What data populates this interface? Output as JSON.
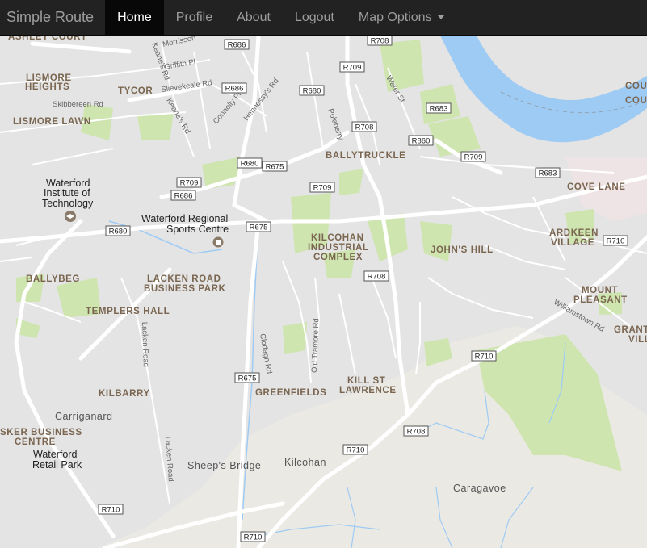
{
  "navbar": {
    "brand": "Simple Route",
    "items": [
      {
        "label": "Home",
        "active": true
      },
      {
        "label": "Profile",
        "active": false
      },
      {
        "label": "About",
        "active": false
      },
      {
        "label": "Logout",
        "active": false
      }
    ],
    "dropdown": {
      "label": "Map Options"
    }
  },
  "map": {
    "colors": {
      "land": "#ebe9e4",
      "urban": "#e4e4e4",
      "park": "#cfe5b0",
      "water": "#9ecbf4",
      "road": "#ffffff",
      "major_road": "#fbfbfb"
    },
    "areas": {
      "ashley_court": "ASHLEY COURT",
      "lismore_heights_1": "LISMORE",
      "lismore_heights_2": "HEIGHTS",
      "tycor": "TYCOR",
      "lismore_lawn": "LISMORE LAWN",
      "ballytruckle": "BALLYTRUCKLE",
      "cove_lane": "COVE LANE",
      "kilcohan_1": "KILCOHAN",
      "kilcohan_2": "INDUSTRIAL",
      "kilcohan_3": "COMPLEX",
      "johns_hill": "JOHN'S HILL",
      "ardkeen_1": "ARDKEEN",
      "ardkeen_2": "VILLAGE",
      "ballybeg": "BALLYBEG",
      "lacken_1": "LACKEN ROAD",
      "lacken_2": "BUSINESS PARK",
      "templers_hall": "TEMPLERS HALL",
      "mount_pleasant_1": "MOUNT",
      "mount_pleasant_2": "PLEASANT",
      "grant_1": "GRANT",
      "grant_2": "VILL",
      "kilbarry": "KILBARRY",
      "greenfields": "GREENFIELDS",
      "kill_st_lawrence_1": "KILL ST",
      "kill_st_lawrence_2": "LAWRENCE",
      "sker_business_1": "SKER BUSINESS",
      "sker_business_2": "CENTRE",
      "count_1": "COUN",
      "count_2": "COUN"
    },
    "pois": {
      "wit_1": "Waterford",
      "wit_2": "Institute of",
      "wit_3": "Technology",
      "sports_1": "Waterford Regional",
      "sports_2": "Sports Centre",
      "retail_1": "Waterford",
      "retail_2": "Retail Park"
    },
    "places": {
      "carriganard": "Carriganard",
      "sheeps_bridge": "Sheep's Bridge",
      "kilcohan": "Kilcohan",
      "caragavoe": "Caragavoe"
    },
    "streets": {
      "morrisson": "Morrisson",
      "griffith": "Griffith Pl",
      "slievekeale": "Slievekeale Rd",
      "keanes_1": "Keane's Rd",
      "keanes_2": "Keane's Rd",
      "skibbereen": "Skibbereen Rd",
      "connolly": "Connolly Pl",
      "hennessys": "Hennessy's Rd",
      "water_st": "Water St",
      "poleberry": "Poleberry",
      "lacken_road_1": "Lacken Road",
      "lacken_road_2": "Lacken Road",
      "clodagh": "Clodagh Rd",
      "old_tramore": "Old Tramore Rd",
      "williamstown": "Williamstown Rd"
    },
    "shields": {
      "s1": "R708",
      "s2": "R686",
      "s3": "R709",
      "s4": "R686",
      "s5": "R680",
      "s6": "R683",
      "s7": "R708",
      "s8": "R860",
      "s9": "R709",
      "s10": "R683",
      "s11": "R680",
      "s12": "R675",
      "s13": "R709",
      "s14": "R709",
      "s15": "R686",
      "s16": "R675",
      "s17": "R680",
      "s18": "R710",
      "s19": "R708",
      "s20": "R710",
      "s21": "R675",
      "s22": "R708",
      "s23": "R710",
      "s24": "R710",
      "s25": "R710"
    }
  }
}
